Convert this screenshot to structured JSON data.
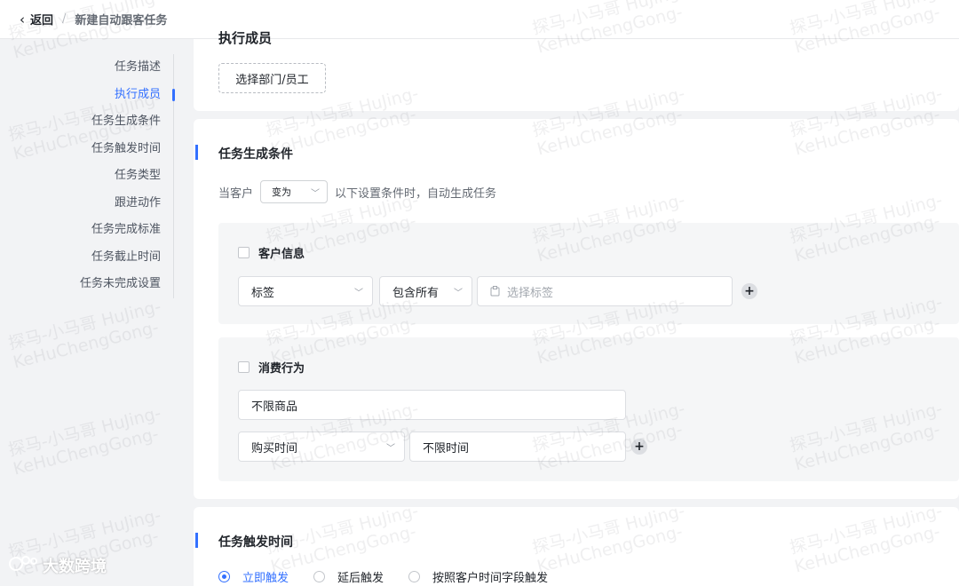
{
  "header": {
    "back_label": "返回",
    "separator": "/",
    "page_title": "新建自动跟客任务"
  },
  "sidenav": {
    "items": [
      {
        "label": "任务描述"
      },
      {
        "label": "执行成员"
      },
      {
        "label": "任务生成条件"
      },
      {
        "label": "任务触发时间"
      },
      {
        "label": "任务类型"
      },
      {
        "label": "跟进动作"
      },
      {
        "label": "任务完成标准"
      },
      {
        "label": "任务截止时间"
      },
      {
        "label": "任务未完成设置"
      }
    ]
  },
  "members": {
    "section_title_partial": "执行成员",
    "select_button": "选择部门/员工"
  },
  "conditions": {
    "title": "任务生成条件",
    "prefix": "当客户",
    "mode_select": "变为",
    "suffix": "以下设置条件时，自动生成任务",
    "customer_info": {
      "label": "客户信息",
      "field_select": "标签",
      "match_select": "包含所有",
      "tag_placeholder": "选择标签"
    },
    "consumption": {
      "label": "消费行为",
      "product_select": "不限商品",
      "time_field_select": "购买时间",
      "time_value_select": "不限时间"
    }
  },
  "trigger": {
    "title": "任务触发时间",
    "options": [
      {
        "label": "立即触发"
      },
      {
        "label": "延后触发"
      },
      {
        "label": "按照客户时间字段触发"
      }
    ]
  },
  "watermark": {
    "line1": "探马-小马哥 HuJing-",
    "line2": "KeHuChengGong-"
  },
  "brand": {
    "name": "大数跨境"
  },
  "colors": {
    "accent": "#3370ff",
    "panel_bg": "#f5f6f7",
    "page_bg": "#f2f3f5"
  }
}
